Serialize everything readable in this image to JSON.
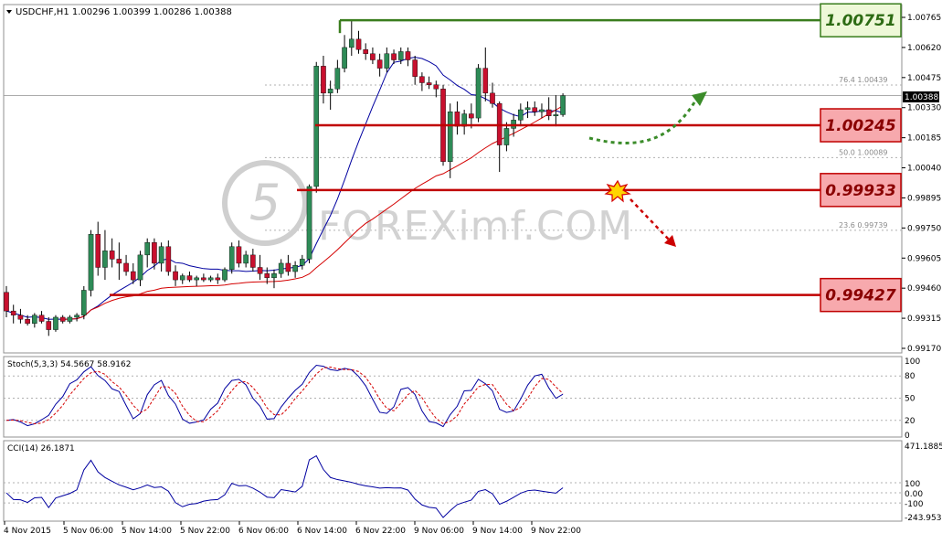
{
  "window": {
    "symbol_header": "USDCHF,H1  1.00296 1.00399 1.00286 1.00388",
    "current_price_tag": "1.00388"
  },
  "watermark": "FOREXimf.COM",
  "levels": [
    {
      "label": "1.00751",
      "value": 1.00751,
      "style": "resistance-green"
    },
    {
      "label": "1.00245",
      "value": 1.00245,
      "style": "red"
    },
    {
      "label": "0.99933",
      "value": 0.99933,
      "style": "red"
    },
    {
      "label": "0.99427",
      "value": 0.99427,
      "style": "red"
    }
  ],
  "fib_labels": [
    {
      "text": "76.4   1.00439",
      "value": 1.00439
    },
    {
      "text": "50.0   1.00089",
      "value": 1.00089
    },
    {
      "text": "23.6   0.99739",
      "value": 0.99739
    }
  ],
  "colors": {
    "bull": "#2e8b57",
    "bear": "#c8102e",
    "ma_fast": "#0000a0",
    "ma_slow": "#d40000",
    "level_red": "#c00000",
    "level_green": "#3a7d1e",
    "box_red_fill": "#f7a9ad",
    "box_red_border": "#c00000",
    "box_green_fill": "#eef8d8",
    "box_green_border": "#3a7d1e",
    "arrow_green": "#3b8c2a",
    "arrow_red": "#cc0000",
    "grid": "#b0b0b0"
  },
  "stoch": {
    "title": "Stoch(5,3,3) 54.5667 58.9162",
    "ticks": [
      "100",
      "80",
      "50",
      "20",
      "0"
    ]
  },
  "cci": {
    "title": "CCI(14) 26.1871",
    "ticks": [
      "471.1885",
      "100",
      "0.00",
      "-100",
      "-243.9532"
    ]
  },
  "chart_data": {
    "type": "candlestick",
    "title": "USDCHF,H1",
    "ylim": [
      0.9917,
      1.0077
    ],
    "y_ticks": [
      "1.00765",
      "1.00620",
      "1.00475",
      "1.00330",
      "1.00185",
      "1.00040",
      "0.99895",
      "0.99750",
      "0.99605",
      "0.99460",
      "0.99315",
      "0.99170"
    ],
    "x_ticks": [
      "4 Nov 2015",
      "5 Nov 06:00",
      "5 Nov 14:00",
      "5 Nov 22:00",
      "6 Nov 06:00",
      "6 Nov 14:00",
      "6 Nov 22:00",
      "9 Nov 06:00",
      "9 Nov 14:00",
      "9 Nov 22:00"
    ],
    "candles": [
      [
        0.9944,
        0.9947,
        0.9932,
        0.9935
      ],
      [
        0.9935,
        0.9938,
        0.9929,
        0.9933
      ],
      [
        0.9933,
        0.9936,
        0.9929,
        0.9931
      ],
      [
        0.9931,
        0.9933,
        0.9928,
        0.9929
      ],
      [
        0.9929,
        0.9934,
        0.9927,
        0.9933
      ],
      [
        0.9933,
        0.9935,
        0.9929,
        0.993
      ],
      [
        0.993,
        0.9932,
        0.9923,
        0.9926
      ],
      [
        0.9926,
        0.9933,
        0.9925,
        0.9932
      ],
      [
        0.9932,
        0.9933,
        0.9929,
        0.993
      ],
      [
        0.993,
        0.9933,
        0.9929,
        0.9932
      ],
      [
        0.9932,
        0.9934,
        0.993,
        0.9933
      ],
      [
        0.9933,
        0.9947,
        0.9931,
        0.9945
      ],
      [
        0.9945,
        0.9974,
        0.9942,
        0.9972
      ],
      [
        0.9972,
        0.9978,
        0.9952,
        0.9956
      ],
      [
        0.9956,
        0.9974,
        0.995,
        0.9964
      ],
      [
        0.9964,
        0.997,
        0.9956,
        0.996
      ],
      [
        0.996,
        0.9968,
        0.995,
        0.9958
      ],
      [
        0.9958,
        0.9962,
        0.9952,
        0.9954
      ],
      [
        0.9954,
        0.9958,
        0.9948,
        0.995
      ],
      [
        0.995,
        0.9964,
        0.9947,
        0.9962
      ],
      [
        0.9962,
        0.997,
        0.9956,
        0.9968
      ],
      [
        0.9968,
        0.997,
        0.9955,
        0.9958
      ],
      [
        0.9958,
        0.9968,
        0.9954,
        0.9966
      ],
      [
        0.9966,
        0.9969,
        0.9952,
        0.9954
      ],
      [
        0.9954,
        0.9957,
        0.9947,
        0.995
      ],
      [
        0.995,
        0.9953,
        0.9948,
        0.9952
      ],
      [
        0.9952,
        0.9954,
        0.9949,
        0.995
      ],
      [
        0.995,
        0.9952,
        0.9947,
        0.9951
      ],
      [
        0.9951,
        0.9953,
        0.9949,
        0.995
      ],
      [
        0.995,
        0.9952,
        0.9949,
        0.9951
      ],
      [
        0.9951,
        0.9953,
        0.9948,
        0.995
      ],
      [
        0.995,
        0.9956,
        0.9949,
        0.9955
      ],
      [
        0.9955,
        0.9968,
        0.9953,
        0.9966
      ],
      [
        0.9966,
        0.9969,
        0.9956,
        0.9958
      ],
      [
        0.9958,
        0.9964,
        0.9956,
        0.9962
      ],
      [
        0.9962,
        0.9965,
        0.9954,
        0.9956
      ],
      [
        0.9956,
        0.9962,
        0.995,
        0.9953
      ],
      [
        0.9953,
        0.9956,
        0.9948,
        0.9951
      ],
      [
        0.9951,
        0.9955,
        0.9946,
        0.9953
      ],
      [
        0.9953,
        0.996,
        0.9951,
        0.9958
      ],
      [
        0.9958,
        0.9962,
        0.9952,
        0.9954
      ],
      [
        0.9954,
        0.9959,
        0.9951,
        0.9957
      ],
      [
        0.9957,
        0.9962,
        0.9955,
        0.996
      ],
      [
        0.996,
        0.9996,
        0.9958,
        0.9995
      ],
      [
        0.9995,
        1.0055,
        0.9992,
        1.0053
      ],
      [
        1.0053,
        1.0058,
        1.0035,
        1.004
      ],
      [
        1.004,
        1.0046,
        1.0032,
        1.0042
      ],
      [
        1.0042,
        1.0056,
        1.004,
        1.0052
      ],
      [
        1.0052,
        1.0068,
        1.005,
        1.0062
      ],
      [
        1.0062,
        1.00751,
        1.0058,
        1.0066
      ],
      [
        1.0066,
        1.007,
        1.0059,
        1.0061
      ],
      [
        1.0061,
        1.0064,
        1.0056,
        1.0059
      ],
      [
        1.0059,
        1.0062,
        1.0054,
        1.0056
      ],
      [
        1.0056,
        1.0059,
        1.0048,
        1.0052
      ],
      [
        1.0052,
        1.0062,
        1.005,
        1.0059
      ],
      [
        1.0059,
        1.0061,
        1.0054,
        1.0056
      ],
      [
        1.0056,
        1.0062,
        1.0054,
        1.006
      ],
      [
        1.006,
        1.0062,
        1.0053,
        1.0056
      ],
      [
        1.0056,
        1.0058,
        1.0044,
        1.0048
      ],
      [
        1.0048,
        1.005,
        1.0041,
        1.0045
      ],
      [
        1.0045,
        1.0048,
        1.0042,
        1.0044
      ],
      [
        1.0044,
        1.0046,
        1.0038,
        1.0042
      ],
      [
        1.0042,
        1.0044,
        1.0005,
        1.0007
      ],
      [
        1.0007,
        1.0035,
        0.9999,
        1.0031
      ],
      [
        1.0031,
        1.0036,
        1.002,
        1.0024
      ],
      [
        1.0024,
        1.0032,
        1.002,
        1.003
      ],
      [
        1.003,
        1.0035,
        1.0023,
        1.0028
      ],
      [
        1.0028,
        1.0054,
        1.0026,
        1.0052
      ],
      [
        1.0052,
        1.0062,
        1.0036,
        1.004
      ],
      [
        1.004,
        1.0045,
        1.0033,
        1.0035
      ],
      [
        1.0035,
        1.0036,
        1.0002,
        1.0015
      ],
      [
        1.0015,
        1.0026,
        1.0012,
        1.0023
      ],
      [
        1.0023,
        1.003,
        1.0019,
        1.0027
      ],
      [
        1.0027,
        1.0035,
        1.0024,
        1.0032
      ],
      [
        1.0032,
        1.0036,
        1.0028,
        1.0033
      ],
      [
        1.0033,
        1.0036,
        1.0029,
        1.0031
      ],
      [
        1.0031,
        1.0035,
        1.0028,
        1.0032
      ],
      [
        1.0032,
        1.0038,
        1.0027,
        1.0029
      ],
      [
        1.0029,
        1.0039,
        1.0024,
        1.00296
      ],
      [
        1.00296,
        1.00399,
        1.00286,
        1.00388
      ]
    ]
  }
}
